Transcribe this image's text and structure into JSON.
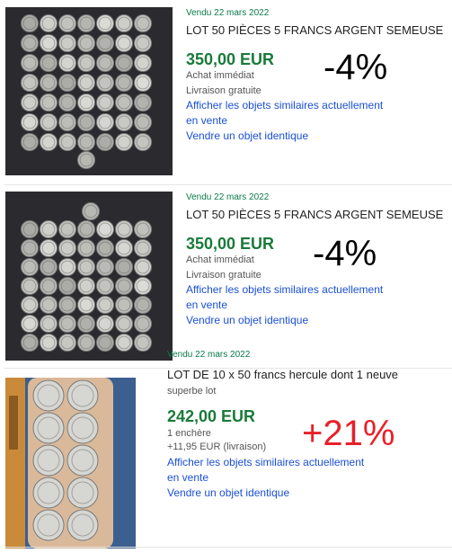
{
  "listings": [
    {
      "date": "Vendu 22 mars 2022",
      "title": "LOT 50 PIÈCES 5 FRANCS ARGENT SEMEUSE",
      "price": "350,00 EUR",
      "purchase_type": "Achat immédiat",
      "shipping": "Livraison gratuite",
      "link_similar_1": "Afficher les objets similaires actuellement",
      "link_similar_2": "en vente",
      "link_sell": "Vendre un objet identique",
      "change": "-4%"
    },
    {
      "date": "Vendu 22 mars 2022",
      "title": "LOT 50 PIÈCES 5 FRANCS ARGENT SEMEUSE",
      "price": "350,00 EUR",
      "purchase_type": "Achat immédiat",
      "shipping": "Livraison gratuite",
      "link_similar_1": "Afficher les objets similaires actuellement",
      "link_similar_2": "en vente",
      "link_sell": "Vendre un objet identique",
      "change": "-4%"
    },
    {
      "date": "Vendu 22 mars 2022",
      "title": "LOT DE 10 x 50 francs hercule dont 1 neuve",
      "subtitle": "superbe lot",
      "price": "242,00 EUR",
      "bids": "1 enchère",
      "shipping": "+11,95 EUR (livraison)",
      "link_similar_1": "Afficher les objets similaires actuellement",
      "link_similar_2": "en vente",
      "link_sell": "Vendre un objet identique",
      "change": "+21%"
    }
  ]
}
